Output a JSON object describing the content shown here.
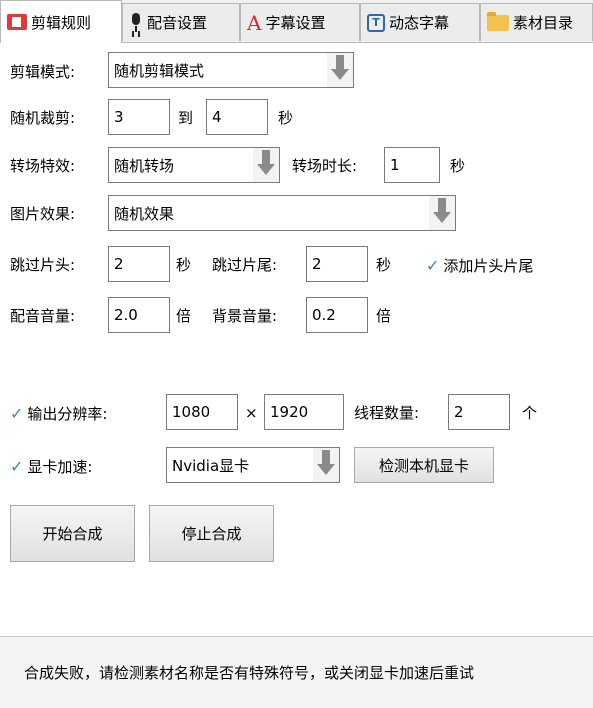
{
  "tabs": [
    {
      "label": "剪辑规则",
      "icon": "rules-icon",
      "active": true
    },
    {
      "label": "配音设置",
      "icon": "microphone-icon",
      "active": false
    },
    {
      "label": "字幕设置",
      "icon": "subtitle-icon",
      "active": false
    },
    {
      "label": "动态字幕",
      "icon": "text-box-icon",
      "active": false
    },
    {
      "label": "素材目录",
      "icon": "folder-icon",
      "active": false
    }
  ],
  "form": {
    "edit_mode": {
      "label": "剪辑模式:",
      "value": "随机剪辑模式"
    },
    "crop": {
      "label": "随机裁剪:",
      "from": "3",
      "to_label": "到",
      "to": "4",
      "unit": "秒"
    },
    "transition": {
      "label": "转场特效:",
      "value": "随机转场",
      "duration_label": "转场时长:",
      "duration": "1",
      "unit": "秒"
    },
    "image_effect": {
      "label": "图片效果:",
      "value": "随机效果"
    },
    "skip": {
      "head_label": "跳过片头:",
      "head": "2",
      "head_unit": "秒",
      "tail_label": "跳过片尾:",
      "tail": "2",
      "tail_unit": "秒",
      "add_head_tail_label": "添加片头片尾",
      "add_head_tail_checked": true
    },
    "volume": {
      "voice_label": "配音音量:",
      "voice": "2.0",
      "voice_unit": "倍",
      "bg_label": "背景音量:",
      "bg": "0.2",
      "bg_unit": "倍"
    },
    "output": {
      "label": "输出分辨率:",
      "checked": true,
      "width": "1080",
      "times": "×",
      "height": "1920",
      "threads_label": "线程数量:",
      "threads": "2",
      "threads_unit": "个"
    },
    "gpu": {
      "label": "显卡加速:",
      "checked": true,
      "value": "Nvidia显卡",
      "detect_label": "检测本机显卡"
    }
  },
  "actions": {
    "start": "开始合成",
    "stop": "停止合成"
  },
  "status": {
    "message": "合成失败，请检测素材名称是否有特殊符号，或关闭显卡加速后重试"
  },
  "colors": {
    "accent_check": "#3d82c8",
    "tab_active_bg": "#ffffff",
    "tab_bg": "#ececec",
    "status_bg": "#f4f4f4"
  }
}
